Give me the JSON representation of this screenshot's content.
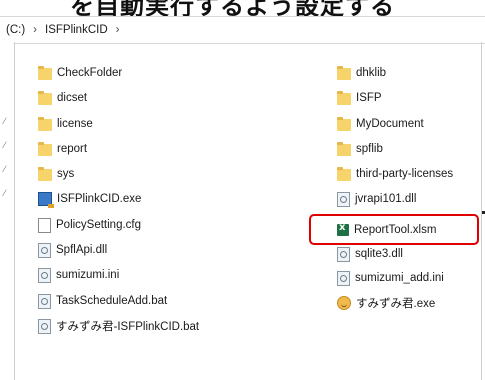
{
  "header_banner": {
    "partial_text": "を自動実行するよう設定する"
  },
  "address_bar": {
    "drive_fragment": "(C:)",
    "separator": "›",
    "folder": "ISFPlinkCID"
  },
  "files_left": [
    {
      "name": "CheckFolder",
      "icon": "folder-icon"
    },
    {
      "name": "dicset",
      "icon": "folder-icon"
    },
    {
      "name": "license",
      "icon": "folder-icon"
    },
    {
      "name": "report",
      "icon": "folder-icon"
    },
    {
      "name": "sys",
      "icon": "folder-icon"
    },
    {
      "name": "ISFPlinkCID.exe",
      "icon": "exe-icon"
    },
    {
      "name": "PolicySetting.cfg",
      "icon": "document-icon"
    },
    {
      "name": "SpflApi.dll",
      "icon": "dll-icon"
    },
    {
      "name": "sumizumi.ini",
      "icon": "ini-icon"
    },
    {
      "name": "TaskScheduleAdd.bat",
      "icon": "bat-icon"
    },
    {
      "name": "すみずみ君-ISFPlinkCID.bat",
      "icon": "bat-icon"
    }
  ],
  "files_right": [
    {
      "name": "dhklib",
      "icon": "folder-icon"
    },
    {
      "name": "ISFP",
      "icon": "folder-icon"
    },
    {
      "name": "MyDocument",
      "icon": "folder-icon"
    },
    {
      "name": "spflib",
      "icon": "folder-icon"
    },
    {
      "name": "third-party-licenses",
      "icon": "folder-icon"
    },
    {
      "name": "jvrapi101.dll",
      "icon": "dll-icon"
    },
    {
      "name": "ReportTool.xlsm",
      "icon": "excel-icon"
    },
    {
      "name": "sqlite3.dll",
      "icon": "dll-icon"
    },
    {
      "name": "sumizumi_add.ini",
      "icon": "ini-icon"
    },
    {
      "name": "すみずみ君.exe",
      "icon": "smiley-exe-icon"
    }
  ],
  "highlighted_file": "ReportTool.xlsm",
  "colors": {
    "highlight": "#e00000",
    "folder": "#f7d36b",
    "excel": "#1e7145"
  }
}
